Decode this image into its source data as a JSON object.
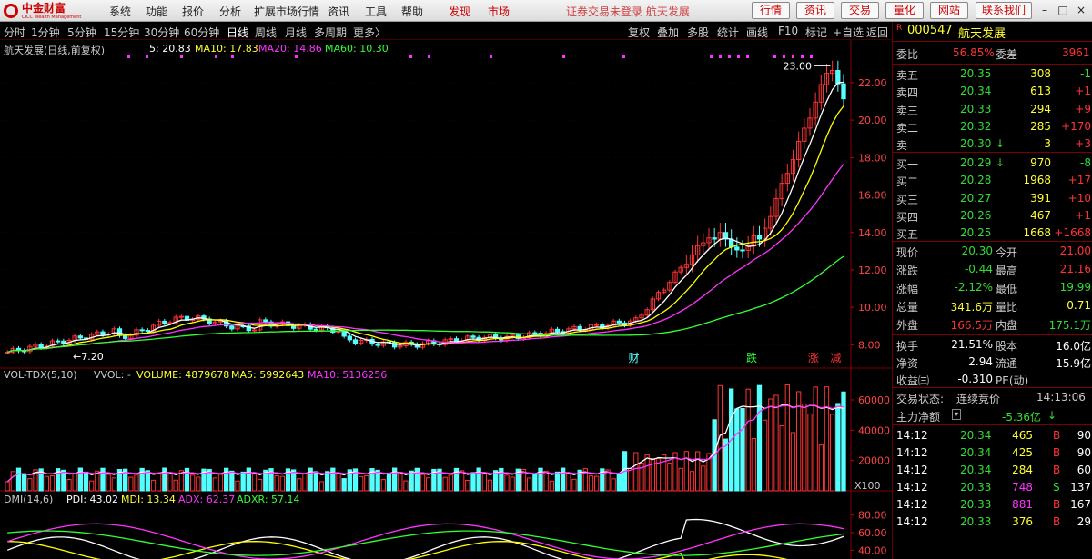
{
  "topbar": {
    "logo_text": "中金财富",
    "logo_sub": "CICC Wealth Management",
    "menu": [
      "系统",
      "功能",
      "报价",
      "分析",
      "扩展市场行情",
      "资讯",
      "工具",
      "帮助"
    ],
    "menu_red": [
      "发现",
      "市场"
    ],
    "login_note": "证券交易未登录  航天发展",
    "buttons": [
      "行情",
      "资讯",
      "交易",
      "量化",
      "网站",
      "联系我们"
    ],
    "win_controls": [
      "–",
      "□",
      "×"
    ]
  },
  "periods": [
    "分时",
    "1分钟",
    "5分钟",
    "15分钟",
    "30分钟",
    "60分钟",
    "日线",
    "周线",
    "月线",
    "多周期",
    "更多〉"
  ],
  "active_period": "日线",
  "tools": [
    "复权",
    "叠加",
    "多股",
    "统计",
    "画线",
    "F10",
    "标记",
    "+自选",
    "返回"
  ],
  "main_pane": {
    "title": "航天发展(日线,前复权)",
    "ma5": "5: 20.83",
    "ma10": "MA10: 17.83",
    "ma20": "MA20: 14.86",
    "ma60": "MA60: 10.30",
    "high_mark": "23.00",
    "low_mark": "7.20",
    "y_ticks": [
      "22.00",
      "20.00",
      "18.00",
      "16.00",
      "14.00",
      "12.00",
      "10.00",
      "8.00"
    ],
    "events": [
      "财",
      "跌",
      "涨",
      "减"
    ]
  },
  "vol_pane": {
    "title": "VOL-TDX(5,10)",
    "vvol": "VVOL: -",
    "volume": "VOLUME: 4879678",
    "ma5": "MA5: 5992643",
    "ma10": "MA10: 5136256",
    "y_ticks": [
      "60000",
      "40000",
      "20000"
    ],
    "unit": "X100"
  },
  "dmi_pane": {
    "title": "DMI(14,6)",
    "pdi": "PDI: 43.02",
    "mdi": "MDI: 13.34",
    "adx": "ADX: 62.37",
    "adxr": "ADXR: 57.14",
    "y_ticks": [
      "80.00",
      "60.00",
      "40.00"
    ]
  },
  "quote": {
    "code": "000547",
    "name": "航天发展",
    "r": "R",
    "weibi_label": "委比",
    "weibi": "56.85%",
    "weicha_label": "委差",
    "weicha": "3961",
    "asks": [
      {
        "label": "卖五",
        "price": "20.35",
        "vol": "308",
        "chg": "-1"
      },
      {
        "label": "卖四",
        "price": "20.34",
        "vol": "613",
        "chg": "+1"
      },
      {
        "label": "卖三",
        "price": "20.33",
        "vol": "294",
        "chg": "+9"
      },
      {
        "label": "卖二",
        "price": "20.32",
        "vol": "285",
        "chg": "+170"
      },
      {
        "label": "卖一",
        "price": "20.30",
        "vol": "3",
        "chg": "+3",
        "arrow": "↓"
      }
    ],
    "bids": [
      {
        "label": "买一",
        "price": "20.29",
        "vol": "970",
        "chg": "-8",
        "arrow": "↓"
      },
      {
        "label": "买二",
        "price": "20.28",
        "vol": "1968",
        "chg": "+17"
      },
      {
        "label": "买三",
        "price": "20.27",
        "vol": "391",
        "chg": "+10"
      },
      {
        "label": "买四",
        "price": "20.26",
        "vol": "467",
        "chg": "+1"
      },
      {
        "label": "买五",
        "price": "20.25",
        "vol": "1668",
        "chg": "+1668"
      }
    ],
    "stats": [
      {
        "l1": "现价",
        "v1": "20.30",
        "l2": "今开",
        "v2": "21.00"
      },
      {
        "l1": "涨跌",
        "v1": "-0.44",
        "l2": "最高",
        "v2": "21.16"
      },
      {
        "l1": "涨幅",
        "v1": "-2.12%",
        "l2": "最低",
        "v2": "19.99"
      },
      {
        "l1": "总量",
        "v1": "341.6万",
        "l2": "量比",
        "v2": "0.71"
      },
      {
        "l1": "外盘",
        "v1": "166.5万",
        "l2": "内盘",
        "v2": "175.1万"
      }
    ],
    "stats2": [
      {
        "l1": "换手",
        "v1": "21.51%",
        "l2": "股本",
        "v2": "16.0亿"
      },
      {
        "l1": "净资",
        "v1": "2.94",
        "l2": "流通",
        "v2": "15.9亿"
      },
      {
        "l1": "收益㈢",
        "v1": "-0.310",
        "l2": "PE(动)",
        "v2": ""
      }
    ],
    "trade_status_label": "交易状态:",
    "trade_status": "连续竞价",
    "trade_time": "14:13:06",
    "net_label": "主力净额",
    "net_value": "-5.36亿",
    "net_arrow": "↓",
    "ticks": [
      {
        "t": "14:12",
        "p": "20.34",
        "v": "465",
        "bs": "B",
        "n": "90"
      },
      {
        "t": "14:12",
        "p": "20.34",
        "v": "425",
        "bs": "B",
        "n": "90"
      },
      {
        "t": "14:12",
        "p": "20.34",
        "v": "284",
        "bs": "B",
        "n": "60"
      },
      {
        "t": "14:12",
        "p": "20.33",
        "v": "748",
        "bs": "S",
        "n": "137"
      },
      {
        "t": "14:12",
        "p": "20.33",
        "v": "881",
        "bs": "B",
        "n": "167"
      },
      {
        "t": "14:12",
        "p": "20.33",
        "v": "376",
        "bs": "B",
        "n": "29"
      }
    ]
  },
  "colors": {
    "up": "#ff3333",
    "down": "#54ffff",
    "ma5": "#ffffff",
    "ma10": "#ffff00",
    "ma20": "#ff33ff",
    "ma60": "#33ff33"
  }
}
